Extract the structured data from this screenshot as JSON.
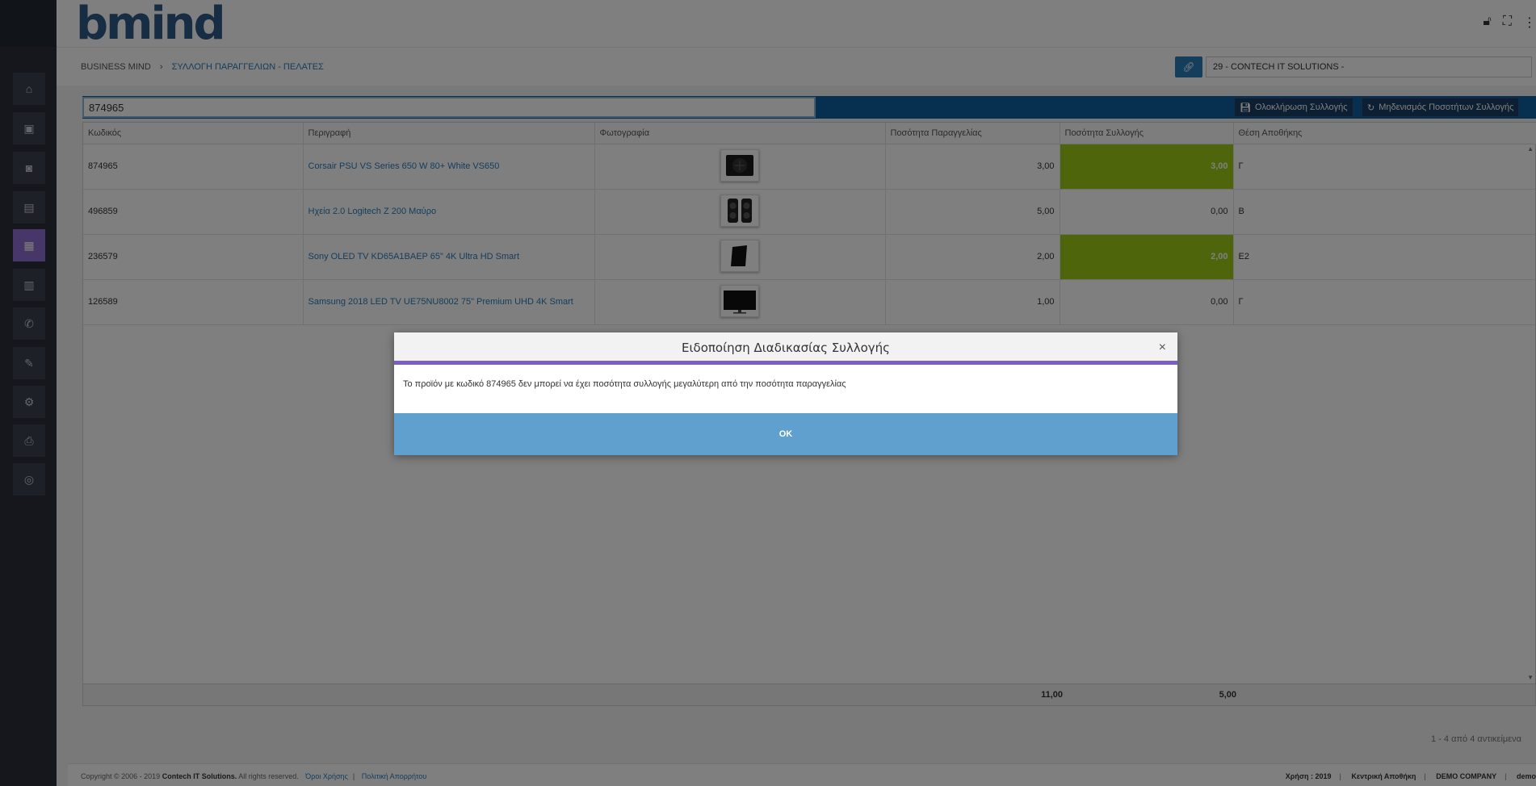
{
  "app": {
    "brand": "bmind"
  },
  "breadcrumb": {
    "root": "BUSINESS MIND",
    "current": "ΣΥΛΛΟΓΗ ΠΑΡΑΓΓΕΛΙΩΝ - ΠΕΛΑΤΕΣ"
  },
  "customer": {
    "value": "29 - CONTECH IT SOLUTIONS -"
  },
  "search": {
    "value": "874965"
  },
  "actions": {
    "complete": "Ολοκλήρωση Συλλογής",
    "reset": "Μηδενισμός Ποσοτήτων Συλλογής"
  },
  "table": {
    "headers": [
      "Κωδικός",
      "Περιγραφή",
      "Φωτογραφία",
      "Ποσότητα Παραγγελίας",
      "Ποσότητα Συλλογής",
      "Θέση Αποθήκης"
    ],
    "rows": [
      {
        "code": "874965",
        "description": "Corsair PSU VS Series 650 W 80+ White VS650",
        "photo_icon": "psu-icon",
        "order_qty": "3,00",
        "collected_qty": "3,00",
        "location": "Γ",
        "highlight": true
      },
      {
        "code": "496859",
        "description": "Ηχεία 2.0 Logitech Z 200 Μαύρο",
        "photo_icon": "speakers-icon",
        "order_qty": "5,00",
        "collected_qty": "0,00",
        "location": "Β",
        "highlight": false
      },
      {
        "code": "236579",
        "description": "Sony OLED TV KD65A1BAEP 65\" 4K Ultra HD Smart",
        "photo_icon": "tv-icon",
        "order_qty": "2,00",
        "collected_qty": "2,00",
        "location": "Ε2",
        "highlight": true
      },
      {
        "code": "126589",
        "description": "Samsung 2018 LED TV UE75NU8002 75\" Premium UHD 4K Smart",
        "photo_icon": "tv-icon",
        "order_qty": "1,00",
        "collected_qty": "0,00",
        "location": "Γ",
        "highlight": false
      }
    ],
    "totals": {
      "order_qty": "11,00",
      "collected_qty": "5,00"
    },
    "pager": "1 - 4 από 4 αντικείμενα"
  },
  "footer": {
    "copyright_prefix": "Copyright © 2006 - 2019",
    "company": "Contech IT Solutions.",
    "rights": "All rights reserved.",
    "terms": "Όροι Χρήσης",
    "privacy": "Πολιτική Απορρήτου",
    "year": "Χρήση : 2019",
    "warehouse": "Κεντρική Αποθήκη",
    "demo_company": "DEMO COMPANY",
    "user": "demo"
  },
  "modal": {
    "title": "Ειδοποίηση Διαδικασίας Συλλογής",
    "message": "Το προϊόν με κωδικό 874965 δεν μπορεί να έχει ποσότητα συλλογής μεγαλύτερη από την ποσότητα παραγγελίας",
    "ok": "OK",
    "close": "×"
  },
  "colors": {
    "accent": "#2b7bb9",
    "highlight_green": "#9ccb19",
    "modal_rule": "#7b5fc4",
    "ok_button": "#5fa0cf"
  }
}
